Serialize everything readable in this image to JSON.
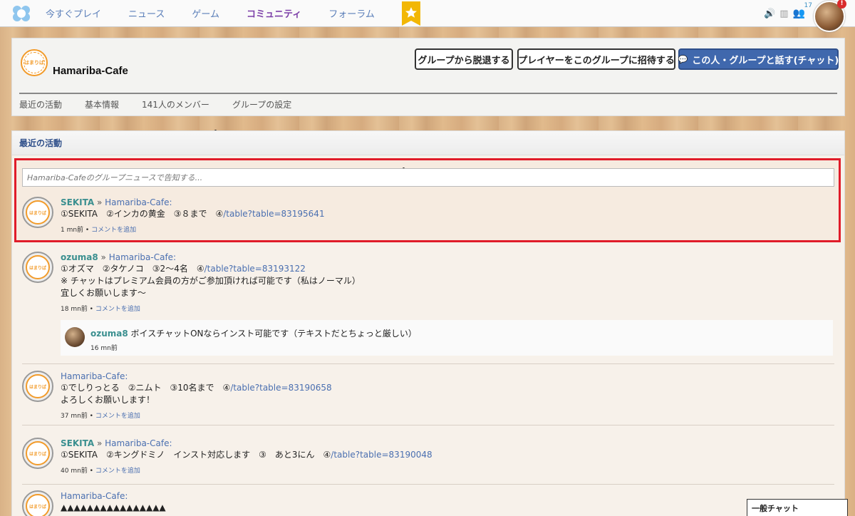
{
  "nav": {
    "items": [
      "今すぐプレイ",
      "ニュース",
      "ゲーム",
      "コミュニティ",
      "フォーラム"
    ],
    "active_index": 3,
    "people_count": "17",
    "alert": "!"
  },
  "group": {
    "name": "Hamariba-Cafe",
    "logo_text": "はまりば",
    "buttons": {
      "leave": "グループから脱退する",
      "invite": "プレイヤーをこのグループに招待する",
      "chat": "この人・グループと話す(チャット)"
    },
    "tabs": [
      "最近の活動",
      "基本情報",
      "141人のメンバー",
      "グループの設定"
    ]
  },
  "activity": {
    "heading": "最近の活動",
    "news_placeholder": "Hamariba-Cafeのグループニュースで告知する...",
    "posts": [
      {
        "user": "SEKITA",
        "sep": " » ",
        "group": "Hamariba-Cafe:",
        "lines": [
          "①SEKITA　②インカの黄金　③８まで　④"
        ],
        "link": "/table?table=83195641",
        "time": "1 mn前 • ",
        "comment_link": "コメントを追加"
      },
      {
        "user": "ozuma8",
        "sep": " » ",
        "group": "Hamariba-Cafe:",
        "lines": [
          "①オズマ　②タケノコ　③2〜4名　④",
          "※ チャットはプレミアム会員の方がご参加頂ければ可能です（私はノーマル）",
          "宜しくお願いします〜"
        ],
        "link": "/table?table=83193122",
        "time": "18 mn前 • ",
        "comment_link": "コメントを追加"
      },
      {
        "user": "",
        "sep": "",
        "group": "Hamariba-Cafe:",
        "lines": [
          "①でしりっとる　②ニムト　③10名まで　④",
          "よろしくお願いします！"
        ],
        "link": "/table?table=83190658",
        "time": "37 mn前 • ",
        "comment_link": "コメントを追加"
      },
      {
        "user": "SEKITA",
        "sep": " » ",
        "group": "Hamariba-Cafe:",
        "lines": [
          "①SEKITA　②キングドミノ　インスト対応します　③　あと3にん　④"
        ],
        "link": "/table?table=83190048",
        "time": "40 mn前 • ",
        "comment_link": "コメントを追加"
      },
      {
        "user": "",
        "sep": "",
        "group": "Hamariba-Cafe:",
        "lines": [
          "▲▲▲▲▲▲▲▲▲▲▲▲▲▲▲▲"
        ]
      }
    ],
    "comment": {
      "user": "ozuma8",
      "text": " ボイスチャットONならインスト可能です（テキストだとちょっと厳しい）",
      "time": "16 mn前"
    }
  },
  "chat_tab": "一般チャット"
}
